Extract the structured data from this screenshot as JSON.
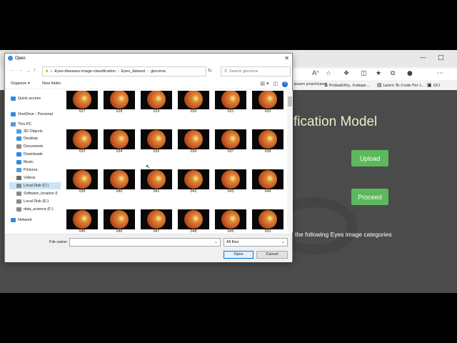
{
  "browser": {
    "bookmarks": [
      {
        "label": "exam practices",
        "icon": ""
      },
      {
        "label": "Probability, Indepe...",
        "icon": "S"
      },
      {
        "label": "Learn To Code For I...",
        "icon": "▤"
      },
      {
        "label": "UCI",
        "icon": "▣"
      }
    ],
    "page_title": "fication Model",
    "upload_label": "Upload",
    "proceed_label": "Proceed",
    "page_text": "the following Eyes image categories"
  },
  "dialog": {
    "title": "Open",
    "path": [
      "Eyes-diseases-image-classification",
      "Eyes_dataset",
      "glucoma"
    ],
    "search_placeholder": "Search glucoma",
    "organize_label": "Organize",
    "new_folder_label": "New folder",
    "sidebar": [
      {
        "label": "Quick access",
        "icon_color": "#2e8de0",
        "indent": 0
      },
      {
        "label": "OneDrive - Personal",
        "icon_color": "#2e8de0",
        "indent": 0
      },
      {
        "label": "This PC",
        "icon_color": "#5b9bd5",
        "indent": 0
      },
      {
        "label": "3D Objects",
        "icon_color": "#4aa3df",
        "indent": 1
      },
      {
        "label": "Desktop",
        "icon_color": "#3c8fd6",
        "indent": 1
      },
      {
        "label": "Documents",
        "icon_color": "#8a8a8a",
        "indent": 1
      },
      {
        "label": "Downloads",
        "icon_color": "#2e8de0",
        "indent": 1
      },
      {
        "label": "Music",
        "icon_color": "#2e8de0",
        "indent": 1
      },
      {
        "label": "Pictures",
        "icon_color": "#5b9bd5",
        "indent": 1
      },
      {
        "label": "Videos",
        "icon_color": "#6a6a6a",
        "indent": 1
      },
      {
        "label": "Local Disk (C:)",
        "icon_color": "#8a8a8a",
        "indent": 1,
        "selected": true
      },
      {
        "label": "Software_location (I",
        "icon_color": "#8a8a8a",
        "indent": 1
      },
      {
        "label": "Local Disk (E:)",
        "icon_color": "#8a8a8a",
        "indent": 1
      },
      {
        "label": "data_science (F:)",
        "icon_color": "#8a8a8a",
        "indent": 1
      },
      {
        "label": "Network",
        "icon_color": "#2e8de0",
        "indent": 0
      }
    ],
    "files": [
      "027",
      "028",
      "029",
      "030",
      "031",
      "032",
      "033",
      "034",
      "035",
      "036",
      "037",
      "038",
      "039",
      "040",
      "041",
      "042",
      "043",
      "044",
      "045",
      "046",
      "047",
      "048",
      "049",
      "050"
    ],
    "file_name_label": "File name:",
    "file_name_value": "",
    "filter_label": "All files",
    "open_label": "Open",
    "cancel_label": "Cancel"
  }
}
